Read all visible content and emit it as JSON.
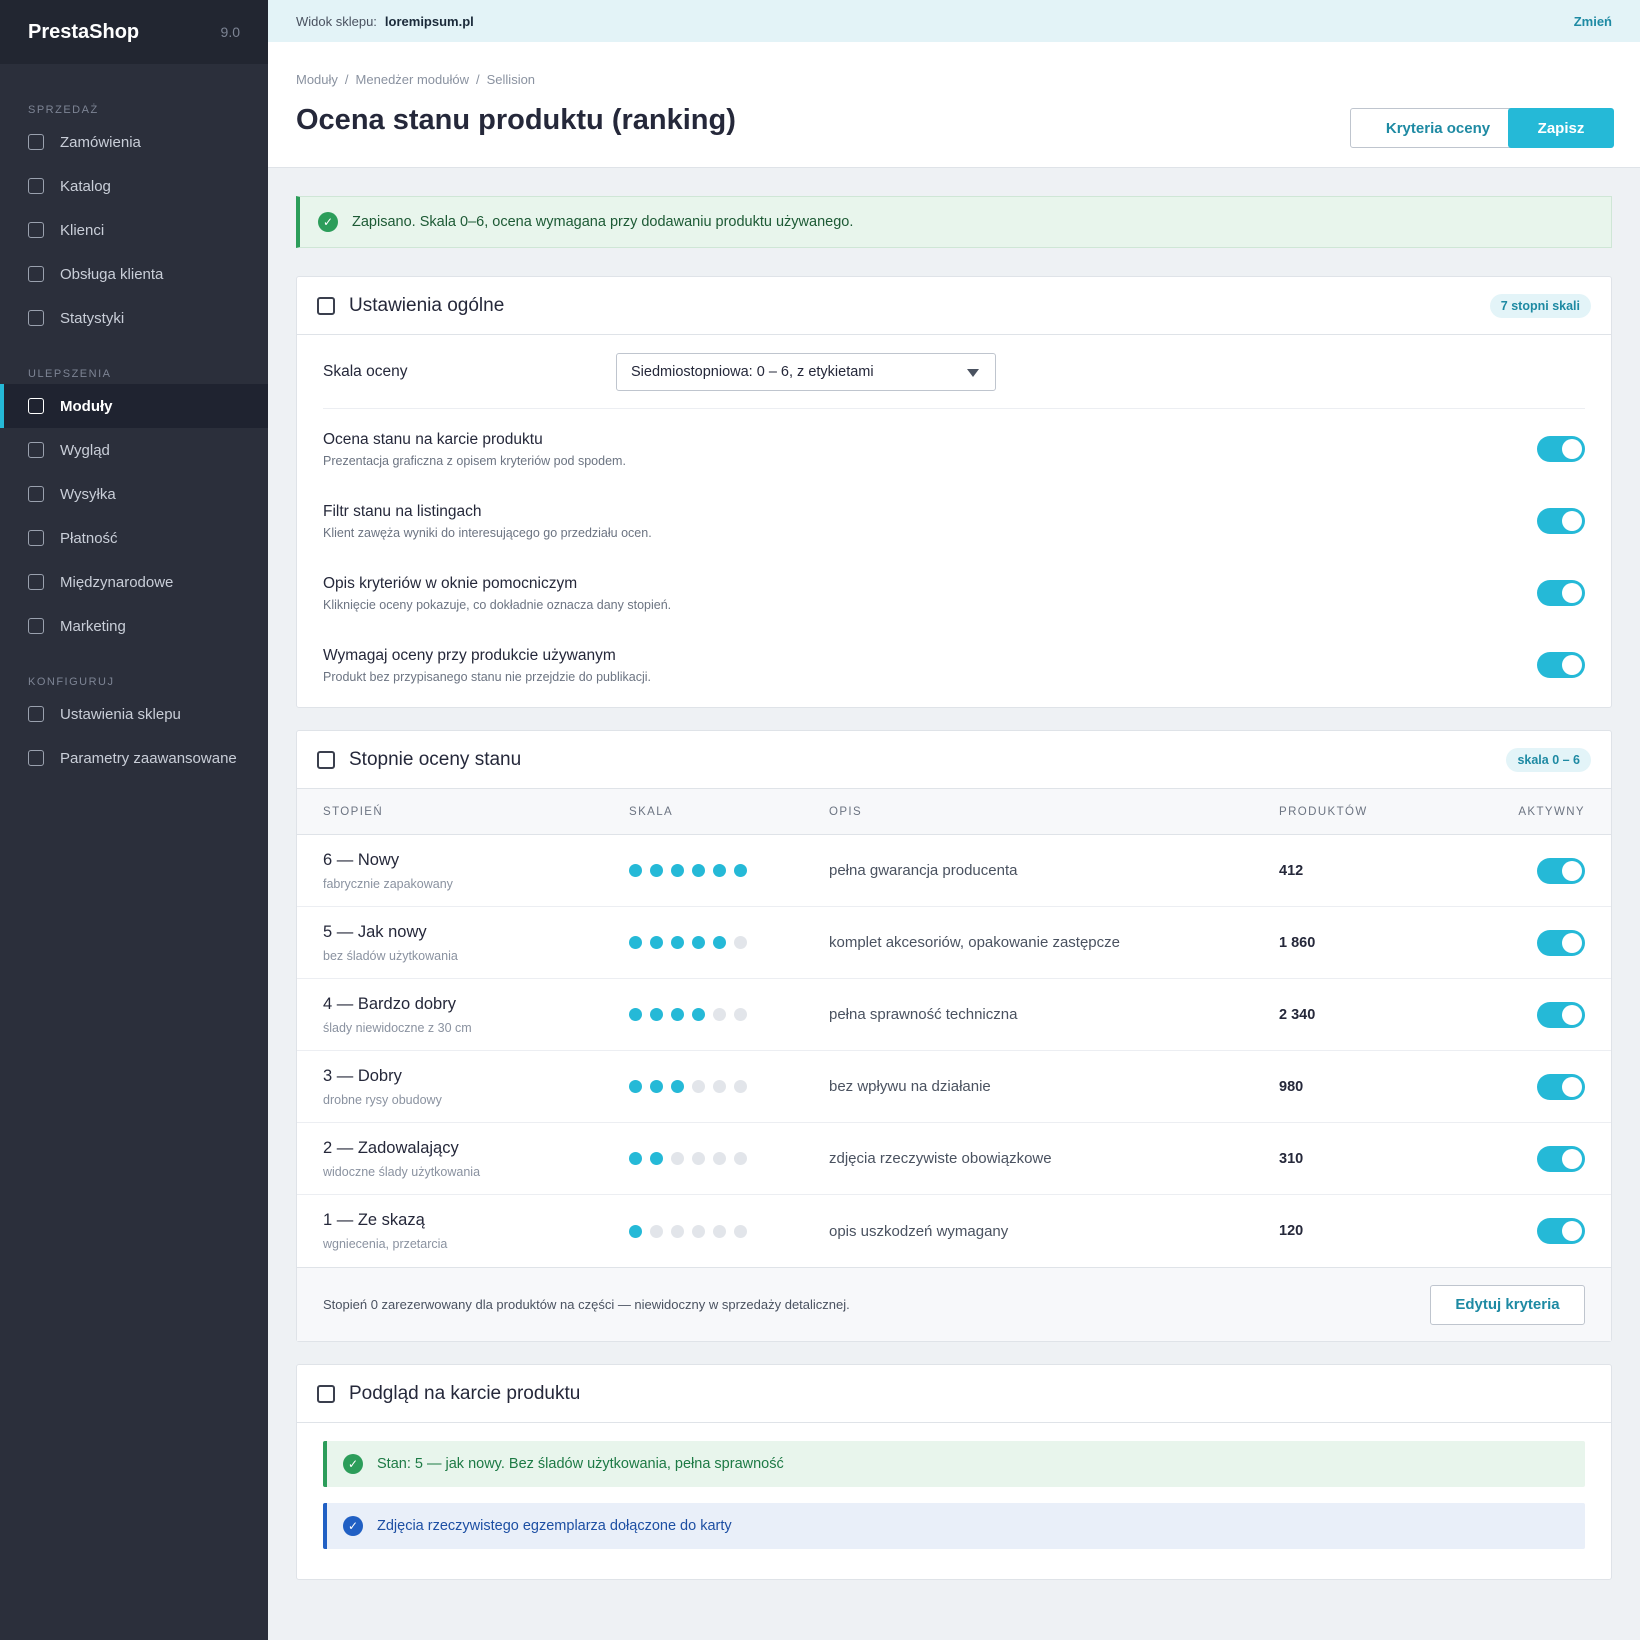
{
  "sidebar": {
    "brand": "PrestaShop",
    "version": "9.0",
    "sections": [
      {
        "title": "SPRZEDAŻ",
        "items": [
          "Zamówienia",
          "Katalog",
          "Klienci",
          "Obsługa klienta",
          "Statystyki"
        ]
      },
      {
        "title": "ULEPSZENIA",
        "items": [
          "Moduły",
          "Wygląd",
          "Wysyłka",
          "Płatność",
          "Międzynarodowe",
          "Marketing"
        ]
      },
      {
        "title": "KONFIGURUJ",
        "items": [
          "Ustawienia sklepu",
          "Parametry zaawansowane"
        ]
      }
    ],
    "active_item": "Moduły"
  },
  "topbar": {
    "label": "Widok sklepu:",
    "store_url": "loremipsum.pl",
    "change": "Zmień"
  },
  "header": {
    "breadcrumb": [
      "Moduły",
      "Menedżer modułów",
      "Sellision"
    ],
    "title": "Ocena stanu produktu (ranking)",
    "criteria_button": "Kryteria oceny",
    "save_button": "Zapisz"
  },
  "alert": {
    "text": "Zapisano. Skala 0–6, ocena wymagana przy dodawaniu produktu używanego."
  },
  "general": {
    "title": "Ustawienia ogólne",
    "badge": "7 stopni skali",
    "scale_label": "Skala oceny",
    "scale_value": "Siedmiostopniowa: 0 – 6, z etykietami",
    "settings": [
      {
        "title": "Ocena stanu na karcie produktu",
        "desc": "Prezentacja graficzna z opisem kryteriów pod spodem.",
        "enabled": true
      },
      {
        "title": "Filtr stanu na listingach",
        "desc": "Klient zawęża wyniki do interesującego go przedziału ocen.",
        "enabled": true
      },
      {
        "title": "Opis kryteriów w oknie pomocniczym",
        "desc": "Kliknięcie oceny pokazuje, co dokładnie oznacza dany stopień.",
        "enabled": true
      },
      {
        "title": "Wymagaj oceny przy produkcie używanym",
        "desc": "Produkt bez przypisanego stanu nie przejdzie do publikacji.",
        "enabled": true
      }
    ]
  },
  "grades": {
    "title": "Stopnie oceny stanu",
    "badge": "skala 0 – 6",
    "columns": [
      "STOPIEŃ",
      "SKALA",
      "OPIS",
      "PRODUKTÓW",
      "AKTYWNY"
    ],
    "rows": [
      {
        "name": "6 — Nowy",
        "sub": "fabrycznie zapakowany",
        "level": 6,
        "desc": "pełna gwarancja producenta",
        "count": "412",
        "active": true
      },
      {
        "name": "5 — Jak nowy",
        "sub": "bez śladów użytkowania",
        "level": 5,
        "desc": "komplet akcesoriów, opakowanie zastępcze",
        "count": "1 860",
        "active": true
      },
      {
        "name": "4 — Bardzo dobry",
        "sub": "ślady niewidoczne z 30 cm",
        "level": 4,
        "desc": "pełna sprawność techniczna",
        "count": "2 340",
        "active": true
      },
      {
        "name": "3 — Dobry",
        "sub": "drobne rysy obudowy",
        "level": 3,
        "desc": "bez wpływu na działanie",
        "count": "980",
        "active": true
      },
      {
        "name": "2 — Zadowalający",
        "sub": "widoczne ślady użytkowania",
        "level": 2,
        "desc": "zdjęcia rzeczywiste obowiązkowe",
        "count": "310",
        "active": true
      },
      {
        "name": "1 — Ze skazą",
        "sub": "wgniecenia, przetarcia",
        "level": 1,
        "desc": "opis uszkodzeń wymagany",
        "count": "120",
        "active": true
      }
    ],
    "footer_note": "Stopień 0 zarezerwowany dla produktów na części — niewidoczny w sprzedaży detalicznej.",
    "edit_button": "Edytuj kryteria"
  },
  "preview": {
    "title": "Podgląd na karcie produktu",
    "condition": "Stan: 5 — jak nowy. Bez śladów użytkowania, pełna sprawność",
    "photos": "Zdjęcia rzeczywistego egzemplarza dołączone do karty"
  },
  "colors": {
    "accent": "#25b9d7",
    "sidebar": "#2b2f3b",
    "success": "#2c9d5a",
    "info": "#2160c4"
  }
}
